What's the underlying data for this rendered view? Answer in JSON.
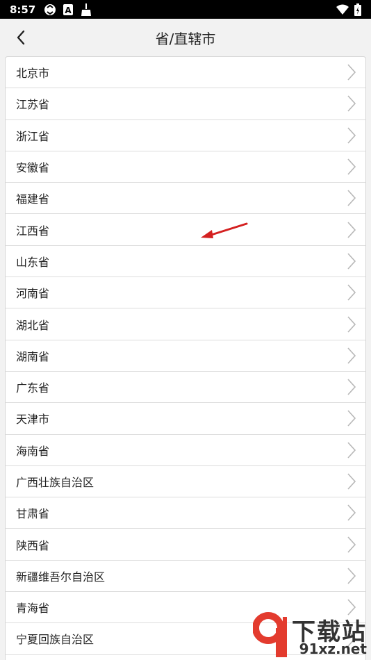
{
  "status_bar": {
    "time": "8:57"
  },
  "header": {
    "title": "省/直辖市"
  },
  "provinces": [
    "北京市",
    "江苏省",
    "浙江省",
    "安徽省",
    "福建省",
    "江西省",
    "山东省",
    "河南省",
    "湖北省",
    "湖南省",
    "广东省",
    "天津市",
    "海南省",
    "广西壮族自治区",
    "甘肃省",
    "陕西省",
    "新疆维吾尔自治区",
    "青海省",
    "宁夏回族自治区"
  ],
  "watermark": {
    "main": "下载站",
    "sub": "91xz.net"
  },
  "colors": {
    "accent_arrow": "#d42020",
    "watermark_red": "#e33b2e"
  }
}
